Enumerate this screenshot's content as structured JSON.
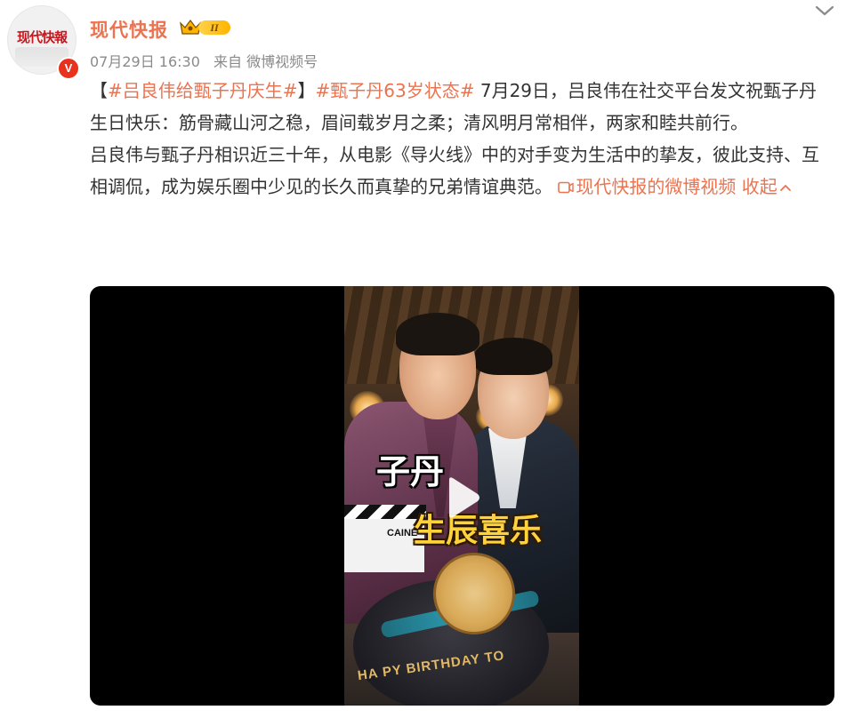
{
  "author": {
    "name": "现代快报",
    "avatar_text": "现代快報",
    "verified_mark": "V",
    "level_label": "II"
  },
  "meta": {
    "time": "07月29日 16:30",
    "source": "来自 微博视频号"
  },
  "post": {
    "bracket_open": "【",
    "hashtag_1": "#吕良伟给甄子丹庆生#",
    "bracket_close": "】",
    "hashtag_2": "#甄子丹63岁状态#",
    "para1_rest": " 7月29日，吕良伟在社交平台发文祝甄子丹生日快乐：筋骨藏山河之稳，眉间载岁月之柔；清风明月常相伴，两家和睦共前行。",
    "para2": "吕良伟与甄子丹相识近三十年，从电影《导火线》中的对手变为生活中的挚友，彼此支持、互相调侃，成为娱乐圈中少见的长久而真挚的兄弟情谊典范。 ",
    "video_link_text": "现代快报的微博视频",
    "collapse_text": "收起"
  },
  "video": {
    "caption_line1": "子丹",
    "caption_line2": "生辰喜乐",
    "clapper_text": "CAINE",
    "cake_text": "HA PY BIRTHDAY TO"
  },
  "colors": {
    "accent": "#eb7350",
    "body_text": "#333333",
    "meta_text": "#8a8a8a",
    "verified": "#e8321e"
  },
  "icons": {
    "collapse_post": "chevron-down-icon",
    "video_link": "video-link-icon",
    "collapse_text": "chevron-up-icon",
    "play": "play-icon"
  }
}
